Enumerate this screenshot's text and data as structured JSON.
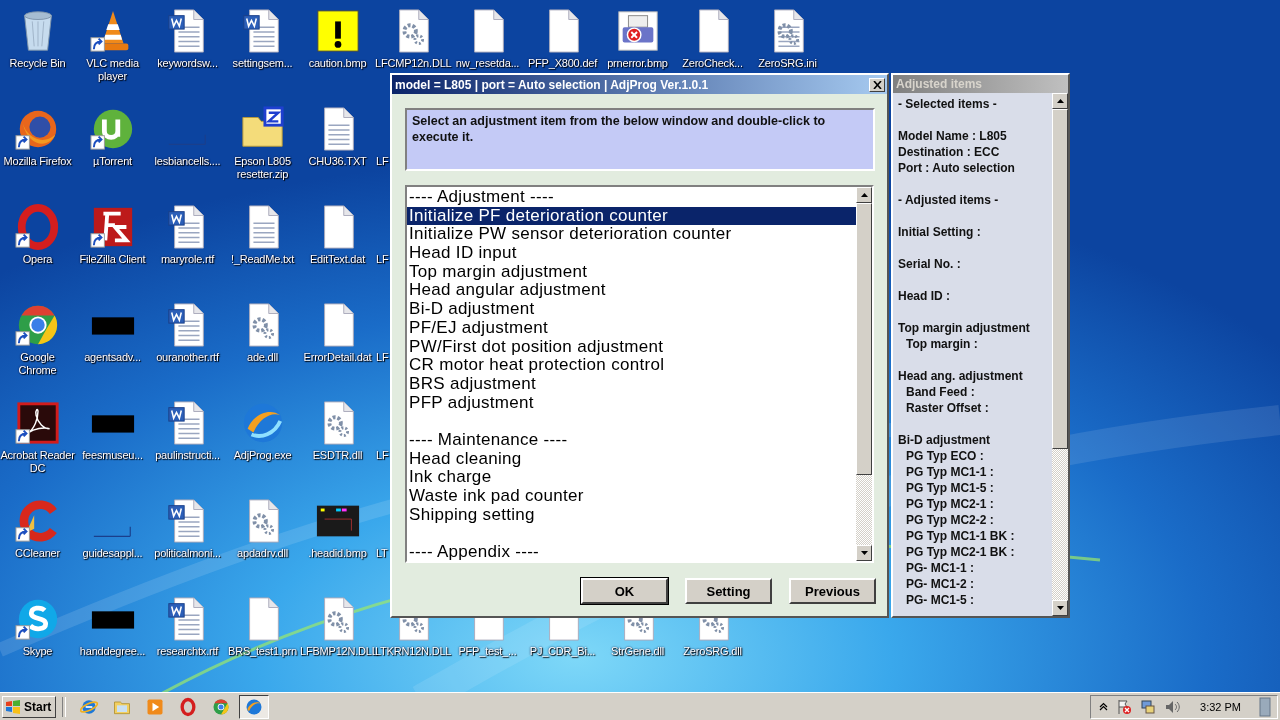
{
  "desktop": {
    "rows": [
      [
        {
          "label": "Recycle Bin",
          "kind": "recycle",
          "shortcut": false
        },
        {
          "label": "VLC media player",
          "kind": "vlc",
          "shortcut": true
        },
        {
          "label": "keywordsw...",
          "kind": "word",
          "shortcut": false
        },
        {
          "label": "settingsem...",
          "kind": "word",
          "shortcut": false
        },
        {
          "label": "caution.bmp",
          "kind": "caution",
          "shortcut": false
        },
        {
          "label": "LFCMP12n.DLL",
          "kind": "dll",
          "shortcut": false
        },
        {
          "label": "nw_resetda...",
          "kind": "blank",
          "shortcut": false
        },
        {
          "label": "PFP_X800.def",
          "kind": "blank",
          "shortcut": false
        },
        {
          "label": "prnerror.bmp",
          "kind": "printer",
          "shortcut": false
        },
        {
          "label": "ZeroCheck...",
          "kind": "blank",
          "shortcut": false
        },
        {
          "label": "ZeroSRG.ini",
          "kind": "ini",
          "shortcut": false
        }
      ],
      [
        {
          "label": "Mozilla Firefox",
          "kind": "firefox",
          "shortcut": true
        },
        {
          "label": "µTorrent",
          "kind": "utorrent",
          "shortcut": true
        },
        {
          "label": "lesbiancells....",
          "kind": "thin",
          "shortcut": false
        },
        {
          "label": "Epson L805 resetter.zip",
          "kind": "zip",
          "shortcut": false
        },
        {
          "label": "CHU36.TXT",
          "kind": "text",
          "shortcut": false
        },
        {
          "label": "LF",
          "kind": "cut"
        }
      ],
      [
        {
          "label": "Opera",
          "kind": "opera",
          "shortcut": true
        },
        {
          "label": "FileZilla Client",
          "kind": "filezilla",
          "shortcut": true
        },
        {
          "label": "maryrole.rtf",
          "kind": "word",
          "shortcut": false
        },
        {
          "label": "!_ReadMe.txt",
          "kind": "text",
          "shortcut": false
        },
        {
          "label": "EditText.dat",
          "kind": "blank",
          "shortcut": false
        },
        {
          "label": "LF",
          "kind": "cut"
        }
      ],
      [
        {
          "label": "Google Chrome",
          "kind": "chrome",
          "shortcut": true
        },
        {
          "label": "agentsadv...",
          "kind": "black",
          "shortcut": false
        },
        {
          "label": "ouranother.rtf",
          "kind": "word",
          "shortcut": false
        },
        {
          "label": "ade.dll",
          "kind": "dll",
          "shortcut": false
        },
        {
          "label": "ErrorDetail.dat",
          "kind": "blank",
          "shortcut": false
        },
        {
          "label": "LF",
          "kind": "cut"
        }
      ],
      [
        {
          "label": "Acrobat Reader DC",
          "kind": "acrobat",
          "shortcut": true
        },
        {
          "label": "feesmuseu...",
          "kind": "black",
          "shortcut": false
        },
        {
          "label": "paulinstructi...",
          "kind": "word",
          "shortcut": false
        },
        {
          "label": "AdjProg.exe",
          "kind": "adjprog",
          "shortcut": false
        },
        {
          "label": "ESDTR.dll",
          "kind": "dll",
          "shortcut": false
        },
        {
          "label": "LF",
          "kind": "cut"
        }
      ],
      [
        {
          "label": "CCleaner",
          "kind": "ccleaner",
          "shortcut": true
        },
        {
          "label": "guidesappl...",
          "kind": "thin",
          "shortcut": false
        },
        {
          "label": "politicalmoni...",
          "kind": "word",
          "shortcut": false
        },
        {
          "label": "apdadrv.dll",
          "kind": "dll",
          "shortcut": false
        },
        {
          "label": ".headid.bmp",
          "kind": "image",
          "shortcut": false
        },
        {
          "label": "LT",
          "kind": "cut"
        }
      ],
      [
        {
          "label": "Skype",
          "kind": "skype",
          "shortcut": true
        },
        {
          "label": "handdegree...",
          "kind": "black",
          "shortcut": false
        },
        {
          "label": "researchtx.rtf",
          "kind": "word",
          "shortcut": false
        },
        {
          "label": "BRS_test1.prn",
          "kind": "blank",
          "shortcut": false
        },
        {
          "label": "LFBMP12N.DLL",
          "kind": "dll",
          "shortcut": false
        },
        {
          "label": "LTKRN12N.DLL",
          "kind": "dll",
          "shortcut": false
        },
        {
          "label": "PFP_test_...",
          "kind": "blank",
          "shortcut": false
        },
        {
          "label": "PJ_CDR_Bi...",
          "kind": "blank",
          "shortcut": false
        },
        {
          "label": "StrGene.dll",
          "kind": "dll",
          "shortcut": false
        },
        {
          "label": "ZeroSRG.dll",
          "kind": "dll",
          "shortcut": false
        }
      ]
    ]
  },
  "dialog": {
    "title": "model = L805 | port = Auto selection | AdjProg Ver.1.0.1",
    "instruction": "Select an adjustment item from the below window and double-click to execute it.",
    "sections": [
      {
        "header": "---- Adjustment ----",
        "items": [
          {
            "label": "Initialize PF deterioration counter",
            "selected": true
          },
          {
            "label": "Initialize PW sensor deterioration counter",
            "selected": false
          },
          {
            "label": "Head ID input",
            "selected": false
          },
          {
            "label": "Top margin adjustment",
            "selected": false
          },
          {
            "label": "Head angular adjustment",
            "selected": false
          },
          {
            "label": "Bi-D adjustment",
            "selected": false
          },
          {
            "label": "PF/EJ adjustment",
            "selected": false
          },
          {
            "label": "PW/First dot position adjustment",
            "selected": false
          },
          {
            "label": "CR motor heat protection control",
            "selected": false
          },
          {
            "label": "BRS adjustment",
            "selected": false
          },
          {
            "label": "PFP adjustment",
            "selected": false
          }
        ]
      },
      {
        "header": "---- Maintenance ----",
        "items": [
          {
            "label": "Head cleaning",
            "selected": false
          },
          {
            "label": "Ink charge",
            "selected": false
          },
          {
            "label": "Waste ink pad counter",
            "selected": false
          },
          {
            "label": "Shipping setting",
            "selected": false
          }
        ]
      },
      {
        "header": "---- Appendix ----"
      }
    ],
    "buttons": [
      "OK",
      "Setting",
      "Previous"
    ]
  },
  "panel": {
    "title": "Adjusted items",
    "groups": [
      [
        {
          "text": "- Selected items -"
        }
      ],
      [
        {
          "text": "Model Name : L805"
        },
        {
          "text": "Destination : ECC"
        },
        {
          "text": "Port : Auto selection"
        }
      ],
      [
        {
          "text": "- Adjusted items -"
        }
      ],
      [
        {
          "text": "Initial Setting :"
        }
      ],
      [
        {
          "text": "Serial No. :"
        }
      ],
      [
        {
          "text": "Head ID :"
        }
      ],
      [
        {
          "text": "Top margin adjustment",
          "children": [
            "Top margin :"
          ]
        }
      ],
      [
        {
          "text": "Head ang. adjustment",
          "children": [
            "Band Feed :",
            "Raster Offset :"
          ]
        }
      ],
      [
        {
          "text": "Bi-D adjustment",
          "children": [
            "PG Typ ECO :",
            "PG Typ MC1-1 :",
            "PG Typ MC1-5 :",
            "PG Typ MC2-1 :",
            "PG Typ MC2-2 :",
            "PG Typ MC1-1 BK :",
            "PG Typ MC2-1 BK :",
            "PG- MC1-1 :",
            "PG- MC1-2 :",
            "PG- MC1-5 :"
          ]
        }
      ]
    ]
  },
  "taskbar": {
    "start": "Start",
    "quick_launch": [
      {
        "kind": "ie",
        "selected": false
      },
      {
        "kind": "explorer",
        "selected": false
      },
      {
        "kind": "media",
        "selected": false
      },
      {
        "kind": "opera",
        "selected": false
      },
      {
        "kind": "chrome",
        "selected": false
      },
      {
        "kind": "adjprog",
        "selected": true
      }
    ],
    "clock": "3:32 PM"
  }
}
